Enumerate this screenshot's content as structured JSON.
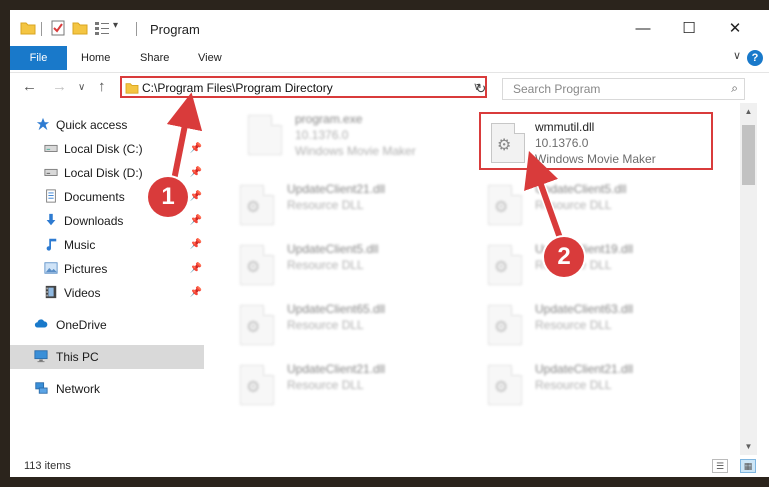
{
  "window": {
    "title": "Program",
    "minimize_glyph": "—",
    "maximize_glyph": "☐",
    "close_glyph": "✕"
  },
  "ribbon": {
    "tabs": [
      "File",
      "Home",
      "Share",
      "View"
    ],
    "help_glyph": "?",
    "collapse_glyph": "∨"
  },
  "nav": {
    "back_glyph": "←",
    "forward_glyph": "→",
    "recent_glyph": "∨",
    "up_glyph": "↑"
  },
  "address": {
    "path": "C:\\Program Files\\Program Directory",
    "dropdown_glyph": "∨",
    "refresh_glyph": "↻"
  },
  "search": {
    "placeholder": "Search Program",
    "icon_glyph": "⌕"
  },
  "sidebar": {
    "items": [
      {
        "label": "Quick access",
        "icon": "star-icon",
        "pinned": false
      },
      {
        "label": "Local Disk (C:)",
        "icon": "drive-icon",
        "pinned": true
      },
      {
        "label": "Local Disk (D:)",
        "icon": "drive-icon",
        "pinned": true
      },
      {
        "label": "Documents",
        "icon": "documents-icon",
        "pinned": true
      },
      {
        "label": "Downloads",
        "icon": "download-icon",
        "pinned": true
      },
      {
        "label": "Music",
        "icon": "music-icon",
        "pinned": true
      },
      {
        "label": "Pictures",
        "icon": "pictures-icon",
        "pinned": true
      },
      {
        "label": "Videos",
        "icon": "videos-icon",
        "pinned": true
      },
      {
        "label": "OneDrive",
        "icon": "cloud-icon",
        "pinned": false
      },
      {
        "label": "This PC",
        "icon": "computer-icon",
        "pinned": false,
        "selected": true
      },
      {
        "label": "Network",
        "icon": "network-icon",
        "pinned": false
      }
    ],
    "pin_glyph": "📌"
  },
  "files": [
    {
      "name": "program.exe",
      "line2": "10.1376.0",
      "line3": "Windows Movie Maker",
      "blurred": true
    },
    {
      "name": "wmmutil.dll",
      "line2": "10.1376.0",
      "line3": "Windows Movie Maker",
      "blurred": false
    },
    {
      "name": "UpdateClient21.dll",
      "line2": "Resource DLL",
      "blurred": true
    },
    {
      "name": "UpdateClient5.dll",
      "line2": "Resource DLL",
      "blurred": true
    },
    {
      "name": "UpdateClient5.dll",
      "line2": "Resource DLL",
      "blurred": true
    },
    {
      "name": "UpdateClient19.dll",
      "line2": "Resource DLL",
      "blurred": true
    },
    {
      "name": "UpdateClient65.dll",
      "line2": "Resource DLL",
      "blurred": true
    },
    {
      "name": "UpdateClient63.dll",
      "line2": "Resource DLL",
      "blurred": true
    },
    {
      "name": "UpdateClient21.dll",
      "line2": "Resource DLL",
      "blurred": true
    },
    {
      "name": "UpdateClient21.dll",
      "line2": "Resource DLL",
      "blurred": true
    }
  ],
  "status": {
    "item_count": "113 items"
  },
  "callouts": [
    {
      "number": "1"
    },
    {
      "number": "2"
    }
  ],
  "colors": {
    "accent": "#1979ca",
    "callout_red": "#d93b3b"
  }
}
